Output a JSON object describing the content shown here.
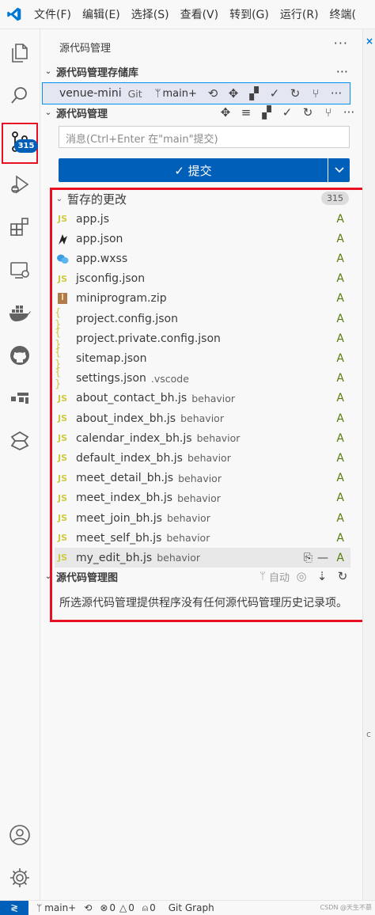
{
  "menubar": {
    "items": [
      "文件(F)",
      "编辑(E)",
      "选择(S)",
      "查看(V)",
      "转到(G)",
      "运行(R)",
      "终端("
    ]
  },
  "activity": {
    "scm_badge": "315"
  },
  "panel": {
    "title": "源代码管理",
    "repos_section": "源代码管理存储库",
    "repo": {
      "name": "venue-mini",
      "provider": "Git",
      "branch": "main+"
    },
    "scm_section": "源代码管理",
    "commit_placeholder": "消息(Ctrl+Enter 在\"main\"提交)",
    "commit_label": "✓ 提交",
    "staged": {
      "label": "暂存的更改",
      "count": "315"
    },
    "files": [
      {
        "name": "app.js",
        "desc": "",
        "icon": "js",
        "status": "A"
      },
      {
        "name": "app.json",
        "desc": "",
        "icon": "mini",
        "status": "A"
      },
      {
        "name": "app.wxss",
        "desc": "",
        "icon": "wxss",
        "status": "A"
      },
      {
        "name": "jsconfig.json",
        "desc": "",
        "icon": "js",
        "status": "A"
      },
      {
        "name": "miniprogram.zip",
        "desc": "",
        "icon": "zip",
        "status": "A"
      },
      {
        "name": "project.config.json",
        "desc": "",
        "icon": "braces",
        "status": "A"
      },
      {
        "name": "project.private.config.json",
        "desc": "",
        "icon": "braces",
        "status": "A"
      },
      {
        "name": "sitemap.json",
        "desc": "",
        "icon": "braces",
        "status": "A"
      },
      {
        "name": "settings.json",
        "desc": ".vscode",
        "icon": "braces",
        "status": "A"
      },
      {
        "name": "about_contact_bh.js",
        "desc": "behavior",
        "icon": "js",
        "status": "A"
      },
      {
        "name": "about_index_bh.js",
        "desc": "behavior",
        "icon": "js",
        "status": "A"
      },
      {
        "name": "calendar_index_bh.js",
        "desc": "behavior",
        "icon": "js",
        "status": "A"
      },
      {
        "name": "default_index_bh.js",
        "desc": "behavior",
        "icon": "js",
        "status": "A"
      },
      {
        "name": "meet_detail_bh.js",
        "desc": "behavior",
        "icon": "js",
        "status": "A"
      },
      {
        "name": "meet_index_bh.js",
        "desc": "behavior",
        "icon": "js",
        "status": "A"
      },
      {
        "name": "meet_join_bh.js",
        "desc": "behavior",
        "icon": "js",
        "status": "A"
      },
      {
        "name": "meet_self_bh.js",
        "desc": "behavior",
        "icon": "js",
        "status": "A"
      },
      {
        "name": "my_edit_bh.js",
        "desc": "behavior",
        "icon": "js",
        "status": "A"
      }
    ],
    "graph_section": "源代码管理图",
    "graph_auto": "自动",
    "graph_message": "所选源代码管理提供程序没有任何源代码管理历史记录项。"
  },
  "statusbar": {
    "branch": "main+",
    "errors": "0",
    "warnings": "0",
    "ports": "0",
    "git_graph": "Git Graph",
    "watermark": "CSDN @天生不慕",
    "scrollbar_glyph": "c"
  },
  "colors": {
    "accent": "#005fb8",
    "highlight_border": "#e81123",
    "added": "#587c0c",
    "js_yellow": "#cbcb41"
  }
}
